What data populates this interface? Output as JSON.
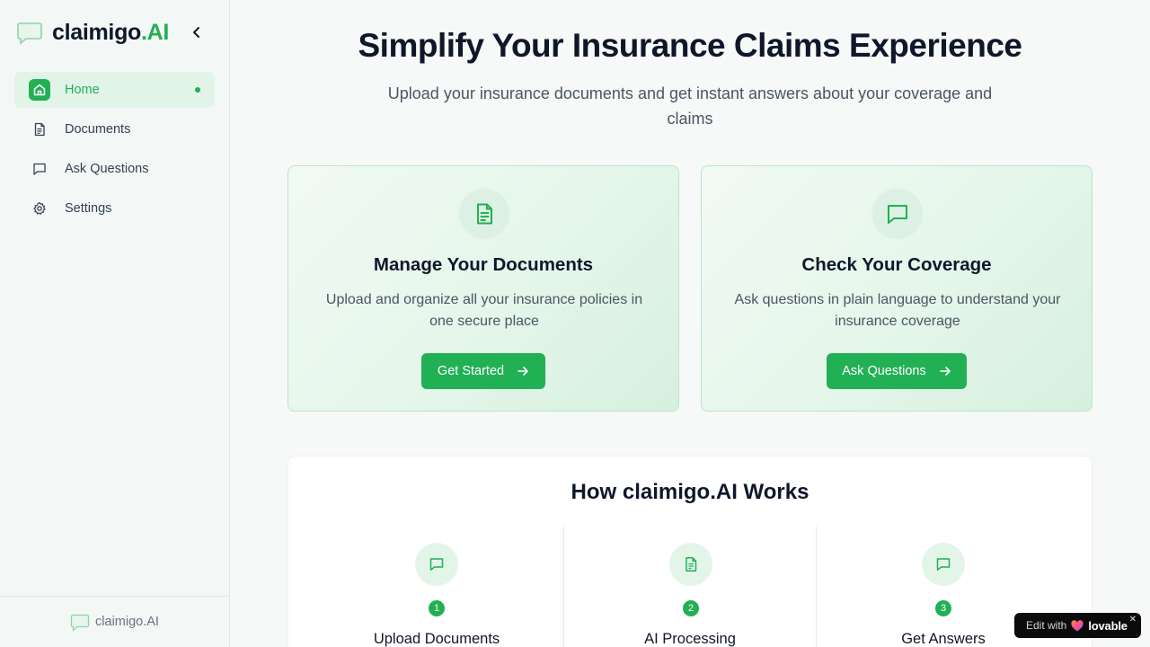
{
  "sidebar": {
    "brand": {
      "name": "claimigo",
      "suffix": ".AI"
    },
    "collapse_icon": "chevron-left-icon",
    "items": [
      {
        "label": "Home",
        "icon": "home-icon",
        "active": true
      },
      {
        "label": "Documents",
        "icon": "file-text-icon",
        "active": false
      },
      {
        "label": "Ask Questions",
        "icon": "message-square-icon",
        "active": false
      },
      {
        "label": "Settings",
        "icon": "gear-icon",
        "active": false
      }
    ],
    "footer_label": "claimigo.AI"
  },
  "hero": {
    "title": "Simplify Your Insurance Claims Experience",
    "subtitle": "Upload your insurance documents and get instant answers about your coverage and claims"
  },
  "cards": [
    {
      "title": "Manage Your Documents",
      "description": "Upload and organize all your insurance policies in one secure place",
      "button": "Get Started",
      "icon": "file-text-icon"
    },
    {
      "title": "Check Your Coverage",
      "description": "Ask questions in plain language to understand your insurance coverage",
      "button": "Ask Questions",
      "icon": "message-square-icon"
    }
  ],
  "how": {
    "title": "How claimigo.AI Works",
    "steps": [
      {
        "number": "1",
        "title": "Upload Documents",
        "icon": "message-square-icon"
      },
      {
        "number": "2",
        "title": "AI Processing",
        "icon": "file-text-icon"
      },
      {
        "number": "3",
        "title": "Get Answers",
        "icon": "message-square-icon"
      }
    ]
  },
  "badge": {
    "prefix": "Edit with",
    "brand": "lovable",
    "close": "✕"
  },
  "colors": {
    "accent": "#22b055",
    "text": "#0f172a",
    "muted": "#4b5563",
    "background": "#f6f9f7"
  }
}
